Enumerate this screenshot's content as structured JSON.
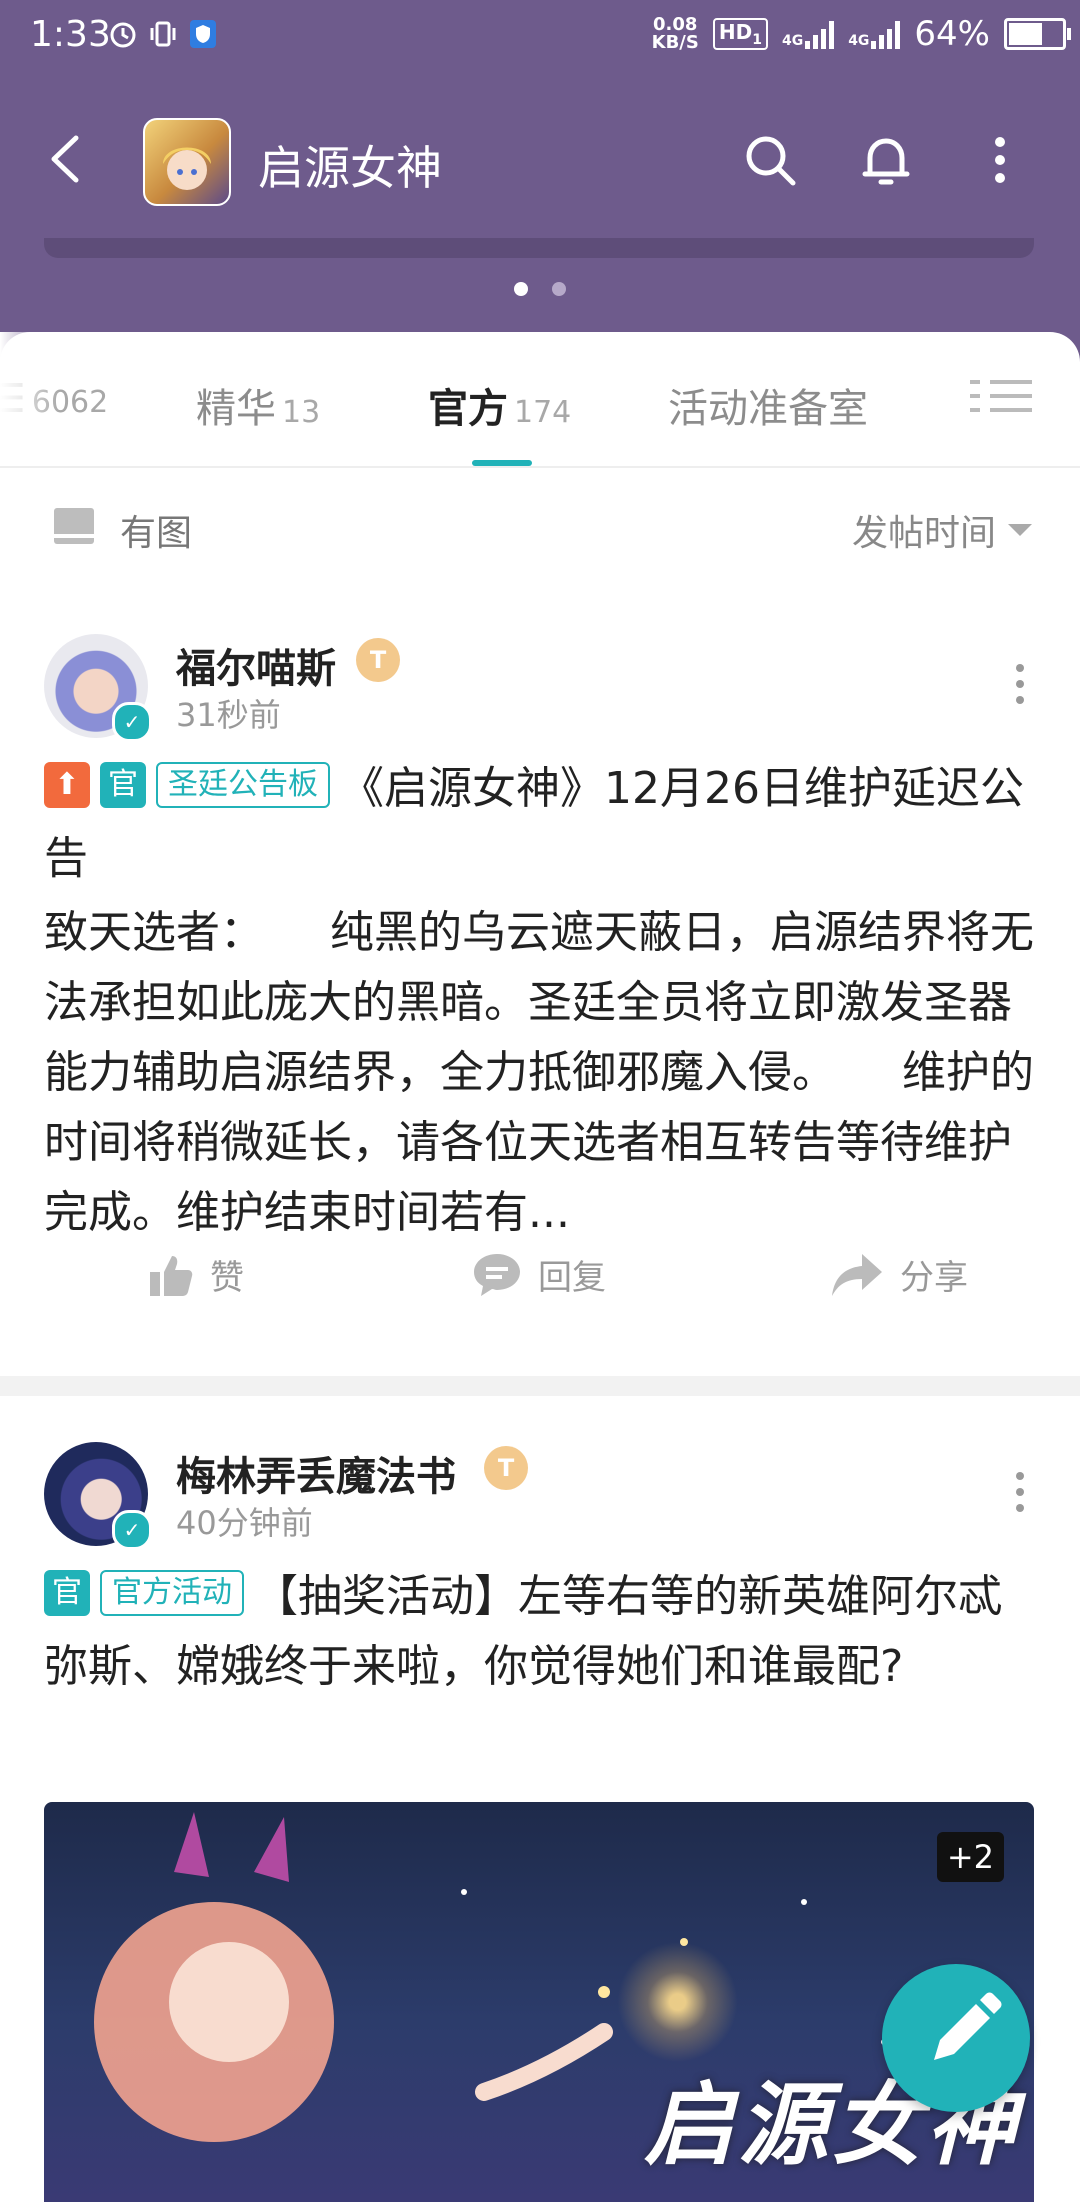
{
  "status_bar": {
    "time": "1:33",
    "net_speed_value": "0.08",
    "net_speed_unit": "KB/S",
    "hd_label": "HD",
    "hd_sub": "1",
    "net_type_1": "4G",
    "net_type_2": "4G",
    "battery_percent": "64%",
    "battery_level": 0.64
  },
  "app_bar": {
    "title": "启源女神"
  },
  "banner": {
    "page_count": 2,
    "active_page": 1
  },
  "tabs": [
    {
      "label": "",
      "count": "6062"
    },
    {
      "label": "精华",
      "count": "13"
    },
    {
      "label": "官方",
      "count": "174",
      "active": true
    },
    {
      "label": "活动准备室",
      "count": ""
    }
  ],
  "filter": {
    "image_label": "有图",
    "sort_label": "发帖时间"
  },
  "posts": [
    {
      "author": "福尔喵斯",
      "level_badge": "T",
      "time_ago": "31秒前",
      "tags": [
        "官",
        "圣廷公告板"
      ],
      "title": "《启源女神》12月26日维护延迟公告",
      "body": "致天选者：　　纯黑的乌云遮天蔽日，启源结界将无法承担如此庞大的黑暗。圣廷全员将立即激发圣器能力辅助启源结界，全力抵御邪魔入侵。　　维护的时间将稍微延长，请各位天选者相互转告等待维护完成。维护结束时间若有...",
      "actions": {
        "like": "赞",
        "reply": "回复",
        "share": "分享"
      }
    },
    {
      "author": "梅林弄丢魔法书",
      "level_badge": "T",
      "time_ago": "40分钟前",
      "tags": [
        "官",
        "官方活动"
      ],
      "title": "【抽奖活动】左等右等的新英雄阿尔忒弥斯、嫦娥终于来啦，你觉得她们和谁最配?",
      "image_extra_count": "+2",
      "image_watermark": "启源女神"
    }
  ],
  "colors": {
    "header": "#6e5b8c",
    "accent": "#21b2b8",
    "up_tag": "#f26a3d"
  }
}
